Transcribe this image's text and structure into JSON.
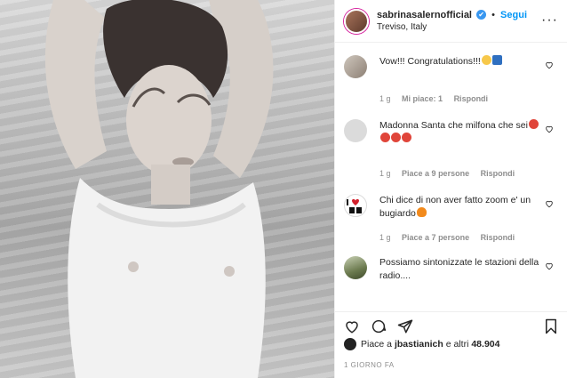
{
  "header": {
    "username": "sabrinasalernofficial",
    "verified_mark": "✔",
    "separator": "•",
    "follow_label": "Segui",
    "location": "Treviso, Italy",
    "more_label": "···"
  },
  "comments": [
    {
      "text": "Vow!!! Congratulations!!!",
      "time": "1 g",
      "likes": "Mi piace: 1",
      "reply": "Rispondi"
    },
    {
      "text": "Madonna Santa che milfona che sei",
      "time": "1 g",
      "likes": "Piace a 9 persone",
      "reply": "Rispondi"
    },
    {
      "text": "Chi dice di non aver fatto zoom e' un bugiardo",
      "time": "1 g",
      "likes": "Piace a 7 persone",
      "reply": "Rispondi"
    },
    {
      "text": "Possiamo sintonizzate le stazioni della radio....",
      "time": "",
      "likes": "",
      "reply": ""
    }
  ],
  "likes": {
    "prefix": "Piace a ",
    "user": "jbastianich",
    "middle": " e altri ",
    "count": "48.904"
  },
  "timestamp": "1 GIORNO FA",
  "icons": {
    "like": "heart-icon",
    "comment": "comment-icon",
    "share": "share-icon",
    "save": "bookmark-icon"
  },
  "colors": {
    "accent": "#0095f6",
    "muted": "#8e8e8e",
    "verified": "#3897f0",
    "emoji_red": "#e0453a",
    "emoji_yellow": "#f7c84a"
  }
}
